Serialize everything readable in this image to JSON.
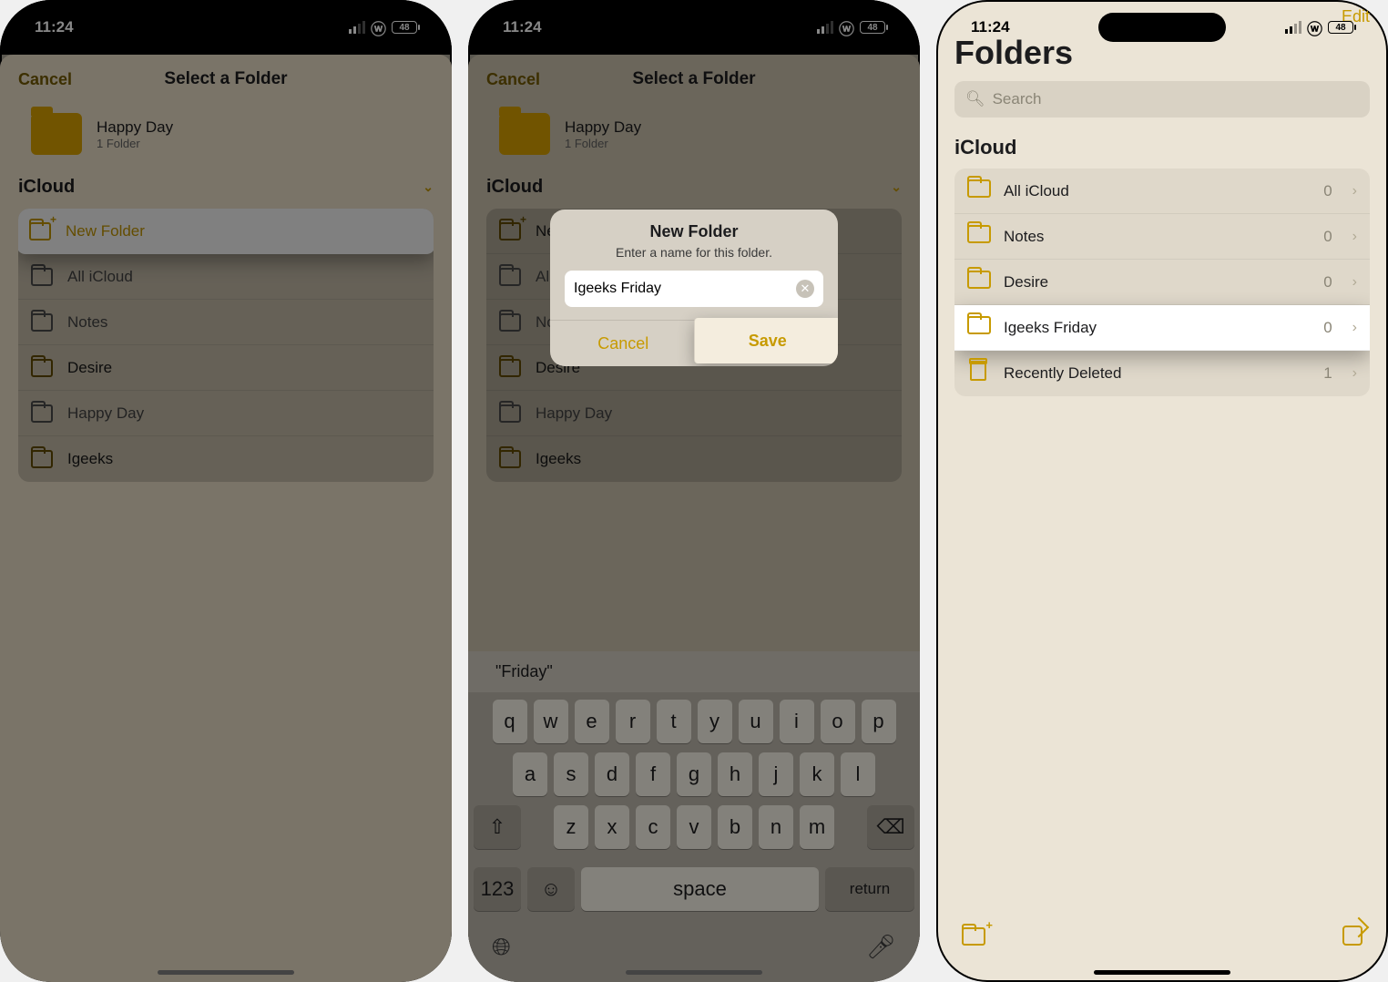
{
  "status": {
    "time": "11:24",
    "battery": "48"
  },
  "screen1": {
    "header_cancel": "Cancel",
    "header_title": "Select a Folder",
    "dest_name": "Happy Day",
    "dest_sub": "1 Folder",
    "section": "iCloud",
    "rows": [
      {
        "label": "New Folder",
        "hl": true,
        "plus": true
      },
      {
        "label": "All iCloud",
        "muted": true
      },
      {
        "label": "Notes",
        "muted": true
      },
      {
        "label": "Desire"
      },
      {
        "label": "Happy Day",
        "muted": true
      },
      {
        "label": "Igeeks"
      }
    ]
  },
  "screen2": {
    "header_cancel": "Cancel",
    "header_title": "Select a Folder",
    "dest_name": "Happy Day",
    "dest_sub": "1 Folder",
    "section": "iCloud",
    "bg_rows": [
      "New Folder",
      "All iCloud",
      "Notes",
      "Desire",
      "Happy Day",
      "Igeeks"
    ],
    "dialog": {
      "title": "New Folder",
      "subtitle": "Enter a name for this folder.",
      "value": "Igeeks Friday",
      "cancel": "Cancel",
      "save": "Save"
    },
    "suggestion": "\"Friday\"",
    "kb": {
      "r1": [
        "q",
        "w",
        "e",
        "r",
        "t",
        "y",
        "u",
        "i",
        "o",
        "p"
      ],
      "r2": [
        "a",
        "s",
        "d",
        "f",
        "g",
        "h",
        "j",
        "k",
        "l"
      ],
      "r3": [
        "z",
        "x",
        "c",
        "v",
        "b",
        "n",
        "m"
      ],
      "num": "123",
      "space": "space",
      "ret": "return"
    }
  },
  "screen3": {
    "edit": "Edit",
    "title": "Folders",
    "search_placeholder": "Search",
    "section": "iCloud",
    "rows": [
      {
        "label": "All iCloud",
        "count": "0"
      },
      {
        "label": "Notes",
        "count": "0"
      },
      {
        "label": "Desire",
        "count": "0"
      },
      {
        "label": "Igeeks Friday",
        "count": "0",
        "hl": true
      },
      {
        "label": "Recently Deleted",
        "count": "1",
        "trash": true
      }
    ]
  }
}
